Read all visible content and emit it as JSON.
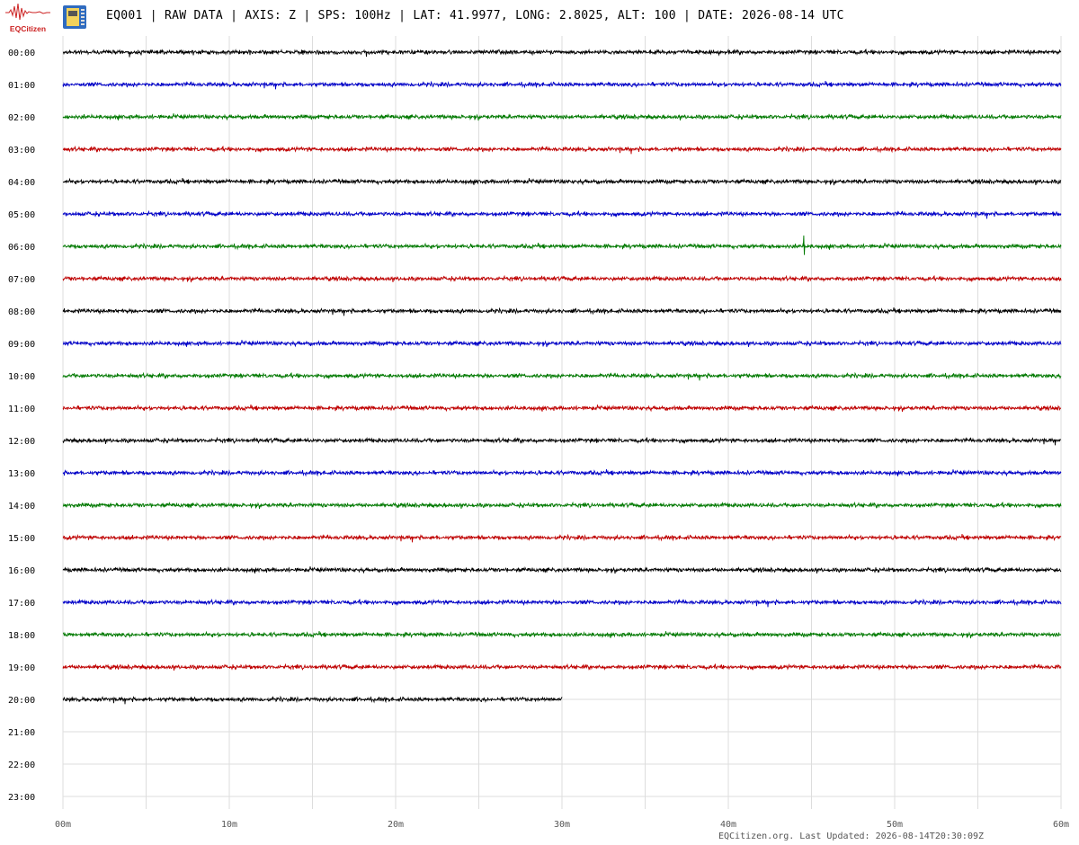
{
  "header": {
    "logo_text": "EQCitizen",
    "title": "EQ001 | RAW DATA | AXIS: Z | SPS: 100Hz | LAT: 41.9977, LONG: 2.8025, ALT: 100 | DATE: 2026-08-14 UTC"
  },
  "footer": {
    "text": "EQCitizen.org. Last Updated: 2026-08-14T20:30:09Z"
  },
  "colors": {
    "trace_cycle": [
      "#000000",
      "#0000c8",
      "#007a00",
      "#c00000"
    ],
    "grid": "#dddddd",
    "logo_red": "#cc2222"
  },
  "icons": [
    "seismograph-logo-icon",
    "device-board-icon"
  ],
  "chart_data": {
    "type": "line",
    "title": "EQ001 | RAW DATA | AXIS: Z | SPS: 100Hz | LAT: 41.9977, LONG: 2.8025, ALT: 100 | DATE: 2026-08-14 UTC",
    "x_tick_labels": [
      "00m",
      "10m",
      "20m",
      "30m",
      "40m",
      "50m",
      "60m"
    ],
    "xlim": [
      0,
      60
    ],
    "x_unit": "minutes",
    "row_labels": [
      "00:00",
      "01:00",
      "02:00",
      "03:00",
      "04:00",
      "05:00",
      "06:00",
      "07:00",
      "08:00",
      "09:00",
      "10:00",
      "11:00",
      "12:00",
      "13:00",
      "14:00",
      "15:00",
      "16:00",
      "17:00",
      "18:00",
      "19:00",
      "20:00",
      "21:00",
      "22:00",
      "23:00"
    ],
    "row_data_end_minute": [
      60,
      60,
      60,
      60,
      60,
      60,
      60,
      60,
      60,
      60,
      60,
      60,
      60,
      60,
      60,
      60,
      60,
      60,
      60,
      60,
      30,
      0,
      0,
      0
    ],
    "vertical_grid_every_minutes": 5,
    "grid": true,
    "notable_events": [
      {
        "row": "06:00",
        "minute": 44.5,
        "relative_amplitude": 3
      }
    ]
  }
}
